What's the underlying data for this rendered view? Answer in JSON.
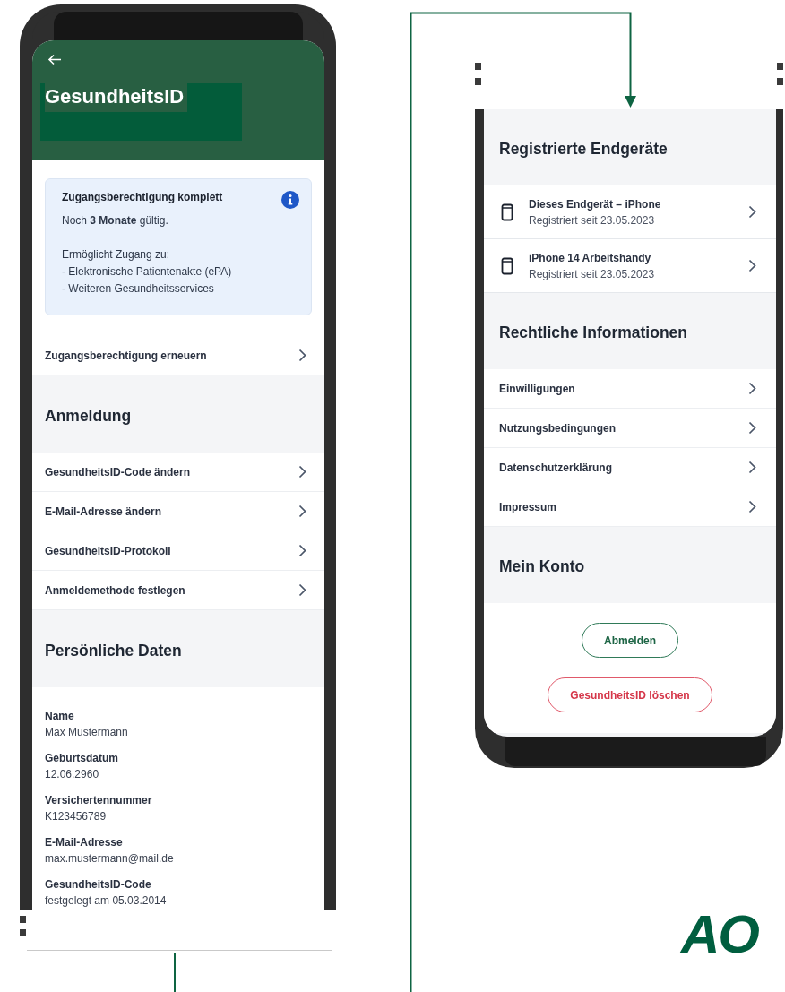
{
  "left_screen": {
    "title": "GesundheitsID",
    "info_card": {
      "title": "Zugangsberechtigung komplett",
      "validity": "Noch **3 Monate** gültig.",
      "access_intro": "Ermöglicht Zugang zu:",
      "access_items": [
        "- Elektronische Patientenakte (ePA)",
        "- Weiteren Gesundheitsservices"
      ]
    },
    "renew_item": "Zugangsberechtigung erneuern",
    "sections": [
      {
        "title": "Anmeldung",
        "items": [
          "GesundheitsID-Code ändern",
          "E-Mail-Adresse ändern",
          "GesundheitsID-Protokoll",
          "Anmeldemethode festlegen"
        ]
      },
      {
        "title": "Persönliche Daten",
        "fields": [
          {
            "label": "Name",
            "value": "Max Mustermann"
          },
          {
            "label": "Geburtsdatum",
            "value": "12.06.2960"
          },
          {
            "label": "Versichertennummer",
            "value": "K123456789"
          },
          {
            "label": "E-Mail-Adresse",
            "value": "max.mustermann@mail.de"
          },
          {
            "label": "GesundheitsID-Code",
            "value": "festgelegt am 05.03.2014"
          }
        ]
      }
    ]
  },
  "right_screen": {
    "sections": [
      {
        "title": "Registrierte Endgeräte",
        "devices": [
          {
            "name": "Dieses Endgerät – iPhone",
            "detail": "Registriert seit 23.05.2023"
          },
          {
            "name": "iPhone 14 Arbeitshandy",
            "detail": "Registriert seit 23.05.2023"
          }
        ]
      },
      {
        "title": "Rechtliche Informationen",
        "items": [
          "Einwilligungen",
          "Nutzungsbedingungen",
          "Datenschutzerklärung",
          "Impressum"
        ]
      },
      {
        "title": "Mein Konto",
        "buttons": [
          {
            "label": "Abmelden",
            "kind": "primary"
          },
          {
            "label": "GesundheitsID löschen",
            "kind": "danger"
          }
        ]
      }
    ]
  },
  "logo": "AO"
}
